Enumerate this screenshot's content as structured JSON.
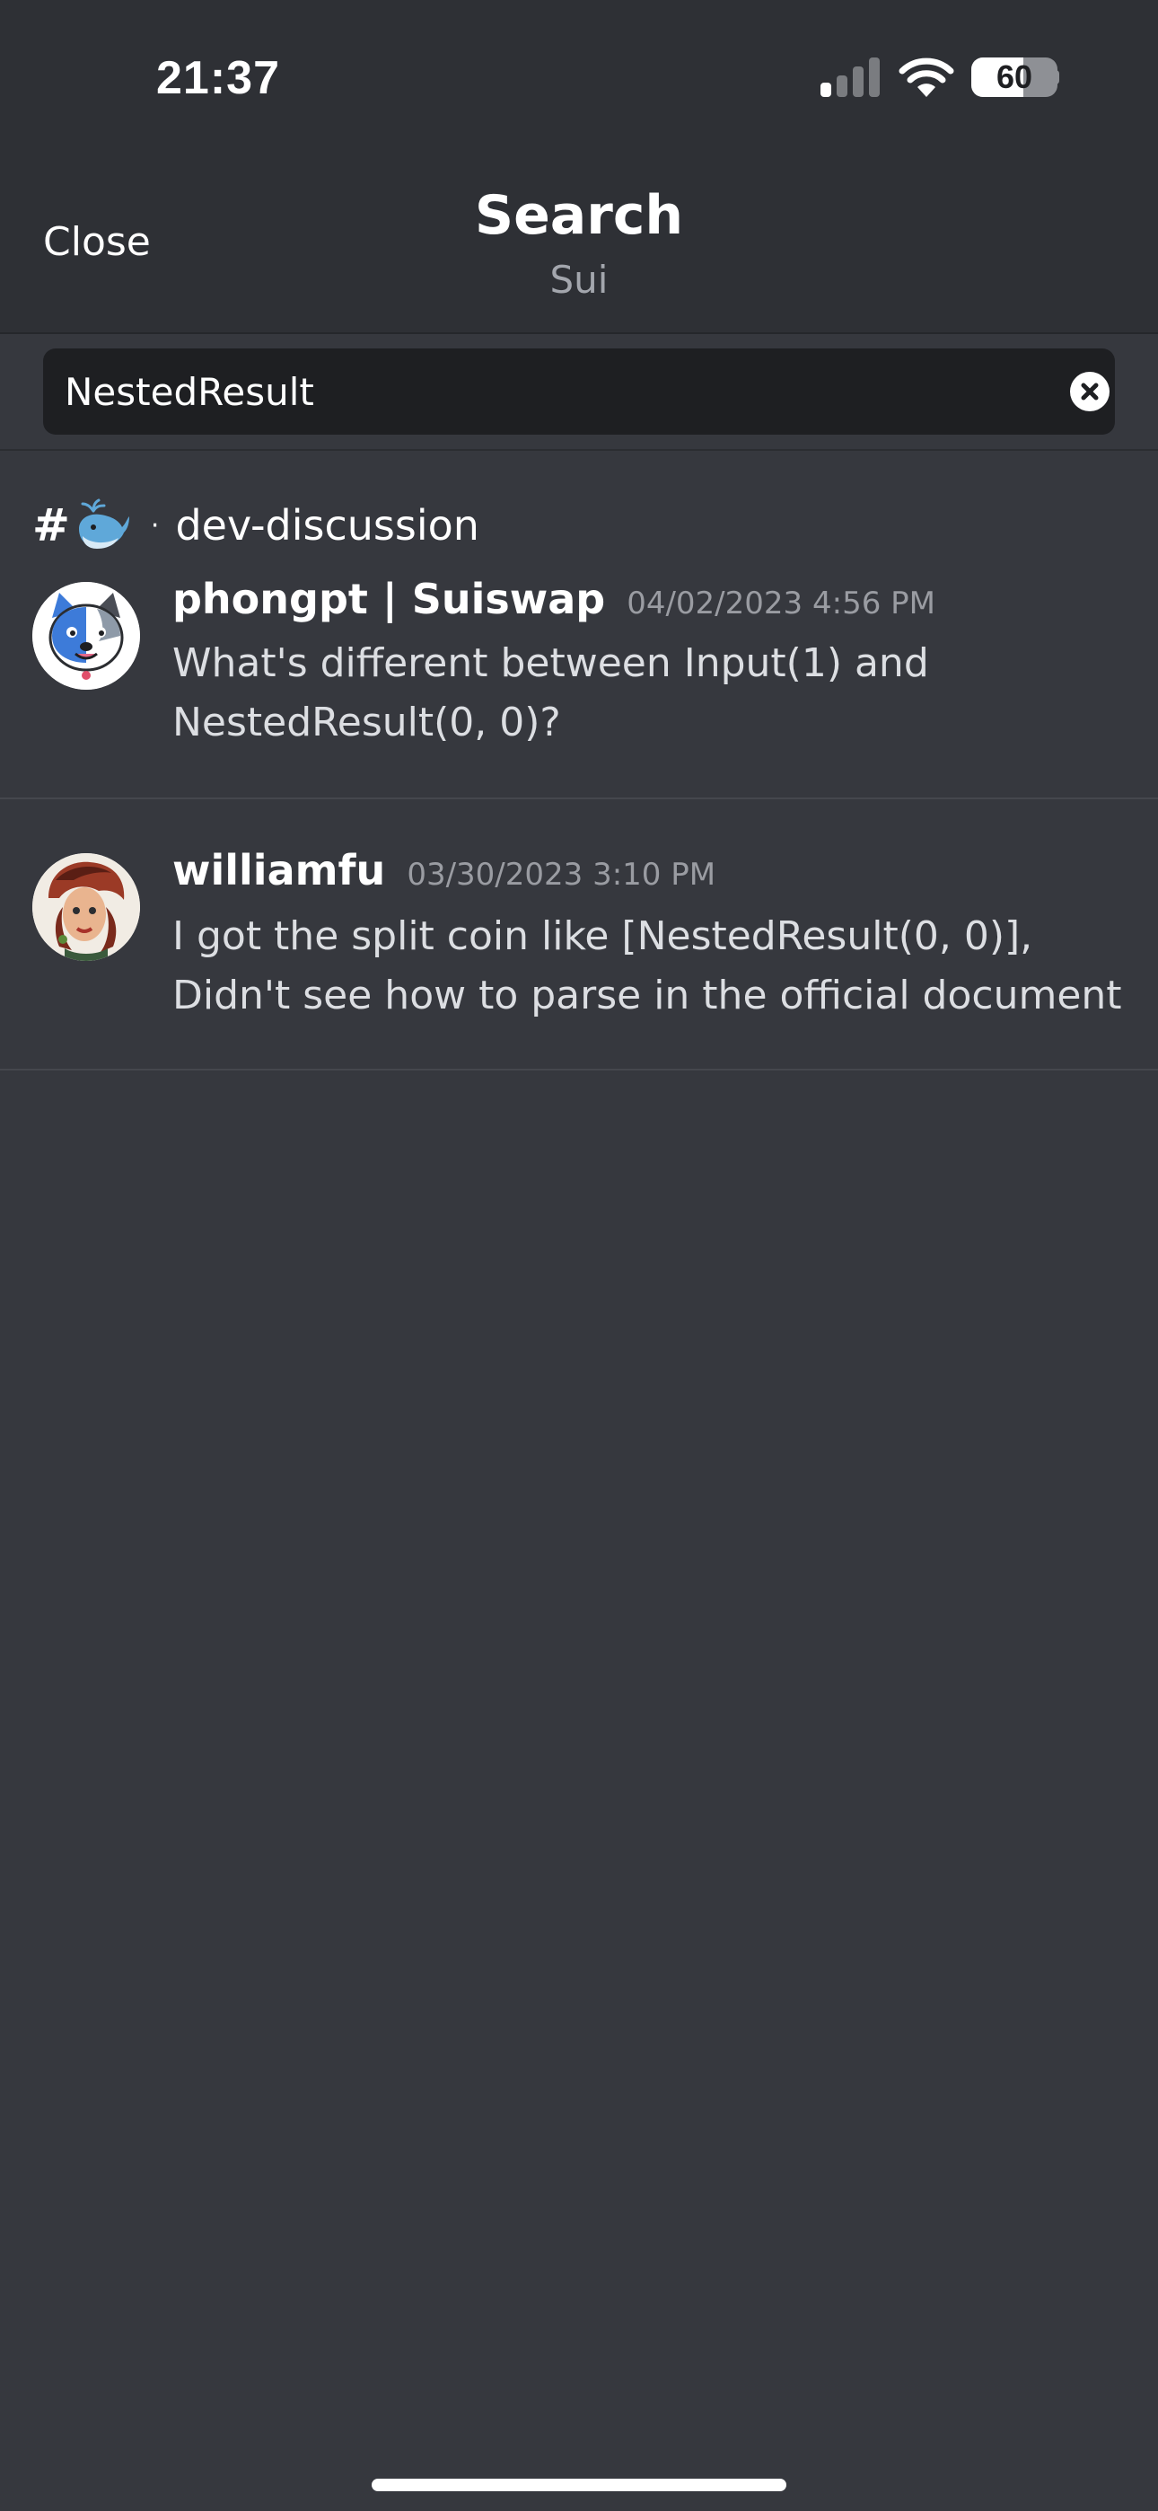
{
  "status_bar": {
    "time": "21:37",
    "signal_bars_active": 1,
    "signal_bars_total": 4,
    "battery_percent": "60",
    "battery_level": 0.6
  },
  "header": {
    "close_label": "Close",
    "title": "Search",
    "subtitle": "Sui"
  },
  "search": {
    "value": "NestedResult",
    "clear_icon": "clear-circle-x-icon"
  },
  "results_group": {
    "channel_prefix": "#",
    "channel_emoji_icon": "whale-icon",
    "separator": "·",
    "channel_name": "dev-discussion"
  },
  "results": [
    {
      "author": "phongpt | Suiswap",
      "timestamp": "04/02/2023 4:56 PM",
      "line1": "What's different between Input(1) and",
      "line2": "NestedResult(0, 0)?",
      "avatar_icon": "dog-avatar-icon"
    },
    {
      "author": "williamfu",
      "timestamp": "03/30/2023 3:10 PM",
      "line1": "I got the split coin like [NestedResult(0, 0)],",
      "line2": "Didn't see how to parse in the official document",
      "avatar_icon": "portrait-avatar-icon"
    }
  ],
  "colors": {
    "background": "#36383e",
    "header_background": "#2e3035",
    "search_field": "#1e1f22",
    "text_primary": "#ffffff",
    "text_secondary": "#a3a6ad"
  }
}
